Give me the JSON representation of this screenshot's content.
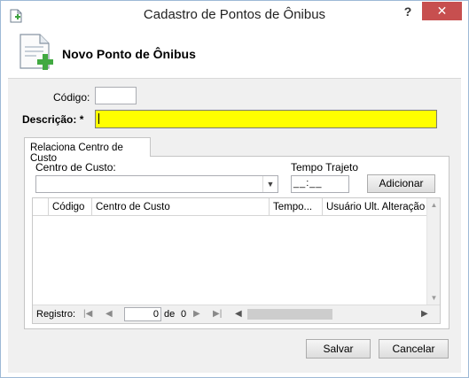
{
  "window": {
    "title": "Cadastro de Pontos de Ônibus",
    "help_label": "?",
    "close_label": "✕"
  },
  "header": {
    "title": "Novo Ponto de Ônibus"
  },
  "form": {
    "codigo_label": "Código:",
    "codigo_value": "",
    "descricao_label": "Descrição: *",
    "descricao_value": ""
  },
  "tab": {
    "label": "Relaciona Centro de Custo"
  },
  "centro": {
    "label": "Centro de Custo:",
    "selected": "",
    "dropdown_icon": "chevron-down-icon"
  },
  "tempo": {
    "label": "Tempo Trajeto",
    "value": "__:__"
  },
  "adicionar_label": "Adicionar",
  "grid": {
    "columns": [
      "Código",
      "Centro de Custo",
      "Tempo...",
      "Usuário Ult. Alteração"
    ],
    "rows": []
  },
  "pager": {
    "label": "Registro:",
    "current": "0",
    "of_label": "de",
    "total": "0"
  },
  "buttons": {
    "save": "Salvar",
    "cancel": "Cancelar"
  },
  "colors": {
    "required_field": "#ffff00",
    "close_button": "#c74f4f"
  }
}
